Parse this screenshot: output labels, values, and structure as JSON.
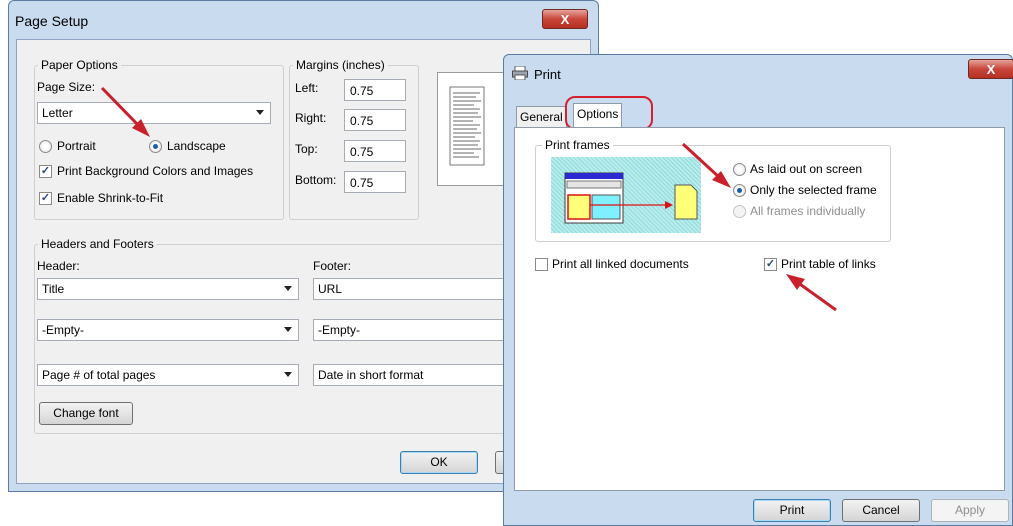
{
  "page_setup": {
    "title": "Page Setup",
    "close_label": "X",
    "paper_options": {
      "group_label": "Paper Options",
      "page_size_label": "Page Size:",
      "page_size_value": "Letter",
      "portrait_label": "Portrait",
      "landscape_label": "Landscape",
      "print_background_label": "Print Background Colors and Images",
      "shrink_to_fit_label": "Enable Shrink-to-Fit"
    },
    "margins": {
      "group_label": "Margins (inches)",
      "left_label": "Left:",
      "left_value": "0.75",
      "right_label": "Right:",
      "right_value": "0.75",
      "top_label": "Top:",
      "top_value": "0.75",
      "bottom_label": "Bottom:",
      "bottom_value": "0.75"
    },
    "headers_footers": {
      "group_label": "Headers and Footers",
      "header_label": "Header:",
      "footer_label": "Footer:",
      "header_1": "Title",
      "header_2": "-Empty-",
      "header_3": "Page # of total pages",
      "footer_1": "URL",
      "footer_2": "-Empty-",
      "footer_3": "Date in short format"
    },
    "change_font_label": "Change font",
    "ok_label": "OK"
  },
  "print": {
    "title": "Print",
    "close_label": "X",
    "tabs": [
      {
        "label": "General"
      },
      {
        "label": "Options"
      }
    ],
    "print_frames": {
      "group_label": "Print frames",
      "as_laid_out_label": "As laid out on screen",
      "only_selected_label": "Only the selected frame",
      "all_frames_label": "All frames individually"
    },
    "print_linked_label": "Print all linked documents",
    "print_table_links_label": "Print table of links",
    "buttons": {
      "print": "Print",
      "cancel": "Cancel",
      "apply": "Apply"
    }
  },
  "colors": {
    "annotation_red": "#c8212c",
    "window_frame": "#c8dbef",
    "dialog_bg": "#f0f0f0"
  }
}
